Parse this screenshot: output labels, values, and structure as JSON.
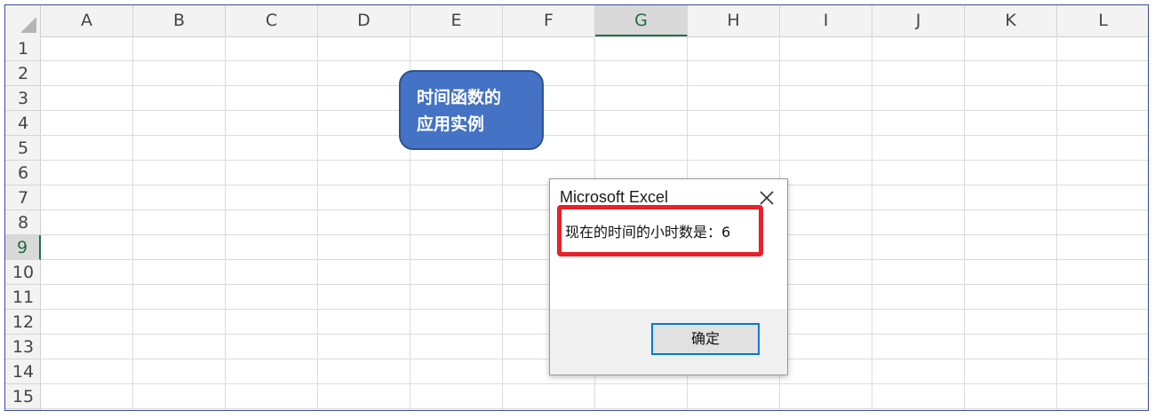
{
  "sheet": {
    "columns": [
      "A",
      "B",
      "C",
      "D",
      "E",
      "F",
      "G",
      "H",
      "I",
      "J",
      "K",
      "L"
    ],
    "rows": [
      "1",
      "2",
      "3",
      "4",
      "5",
      "6",
      "7",
      "8",
      "9",
      "10",
      "11",
      "12",
      "13",
      "14",
      "15"
    ],
    "active_column": "G",
    "active_row": "9",
    "accent_color": "#217346"
  },
  "shape": {
    "line1": "时间函数的",
    "line2": "应用实例",
    "fill_color": "#4472c4"
  },
  "dialog": {
    "title": "Microsoft Excel",
    "close_icon": "close-icon",
    "message": "现在的时间的小时数是：6",
    "ok_label": "确定",
    "highlight_color": "#e8212a"
  }
}
